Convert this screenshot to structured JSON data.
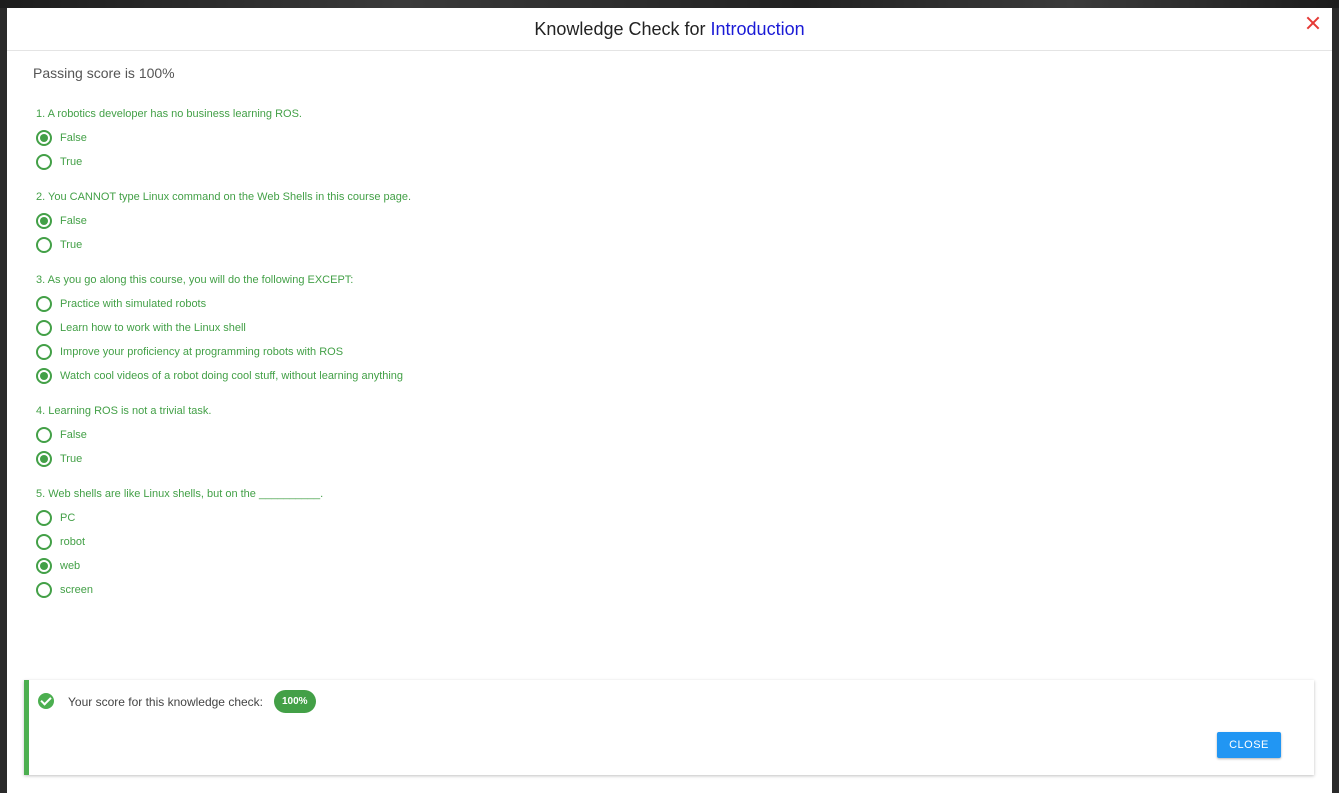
{
  "modal": {
    "title_prefix": "Knowledge Check for",
    "title_topic": "Introduction",
    "passing_score": "Passing score is 100%"
  },
  "questions": [
    {
      "text": "1. A robotics developer has no business learning ROS.",
      "options": [
        {
          "label": "False",
          "selected": true
        },
        {
          "label": "True",
          "selected": false
        }
      ]
    },
    {
      "text": "2. You CANNOT type Linux command on the Web Shells in this course page.",
      "options": [
        {
          "label": "False",
          "selected": true
        },
        {
          "label": "True",
          "selected": false
        }
      ]
    },
    {
      "text": "3. As you go along this course, you will do the following EXCEPT:",
      "options": [
        {
          "label": "Practice with simulated robots",
          "selected": false
        },
        {
          "label": "Learn how to work with the Linux shell",
          "selected": false
        },
        {
          "label": "Improve your proficiency at programming robots with ROS",
          "selected": false
        },
        {
          "label": "Watch cool videos of a robot doing cool stuff, without learning anything",
          "selected": true
        }
      ]
    },
    {
      "text": "4. Learning ROS is not a trivial task.",
      "options": [
        {
          "label": "False",
          "selected": false
        },
        {
          "label": "True",
          "selected": true
        }
      ]
    },
    {
      "text": "5. Web shells are like Linux shells, but on the __________.",
      "options": [
        {
          "label": "PC",
          "selected": false
        },
        {
          "label": "robot",
          "selected": false
        },
        {
          "label": "web",
          "selected": true
        },
        {
          "label": "screen",
          "selected": false
        }
      ]
    }
  ],
  "result": {
    "score_text": "Your score for this knowledge check:",
    "score_value": "100%",
    "close_label": "CLOSE"
  },
  "colors": {
    "accent_green": "#43a047",
    "title_link": "#1a1ad6",
    "close_icon": "#e53935",
    "button_blue": "#2196f3"
  }
}
